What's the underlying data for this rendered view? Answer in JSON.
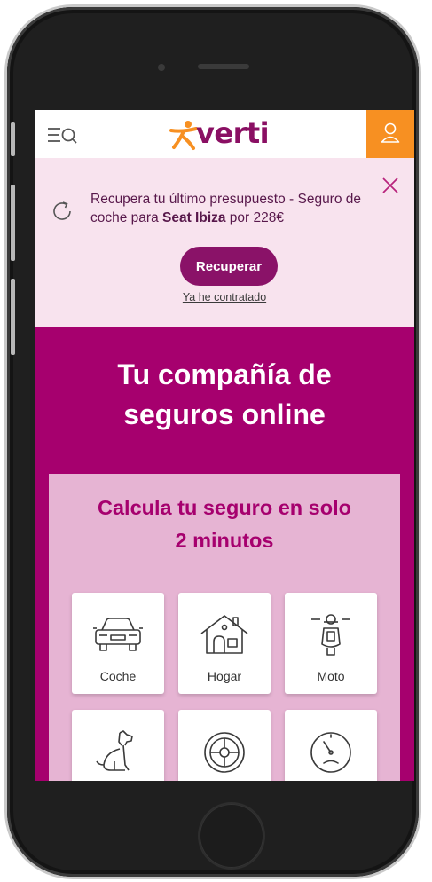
{
  "header": {
    "logo_text": "verti",
    "menu_icon": "menu-search-icon",
    "user_icon": "user-icon",
    "brand_color": "#8a0f63",
    "accent_color": "#f79022"
  },
  "banner": {
    "text_before": "Recupera tu último presupuesto - Seguro de coche para ",
    "vehicle": "Seat Ibiza",
    "text_after": " por 228€",
    "recover_label": "Recuperar",
    "already_label": "Ya he contratado",
    "close_icon": "close-icon",
    "refresh_icon": "refresh-icon"
  },
  "hero": {
    "title_line1": "Tu compañía de",
    "title_line2": "seguros online"
  },
  "calculator": {
    "title_line1": "Calcula tu seguro en solo",
    "title_line2": "2 minutos",
    "products": [
      {
        "label": "Coche",
        "icon": "car-icon"
      },
      {
        "label": "Hogar",
        "icon": "house-icon"
      },
      {
        "label": "Moto",
        "icon": "scooter-icon"
      },
      {
        "label": "",
        "icon": "dog-icon"
      },
      {
        "label": "",
        "icon": "tire-icon"
      },
      {
        "label": "",
        "icon": "speedometer-icon"
      }
    ]
  }
}
